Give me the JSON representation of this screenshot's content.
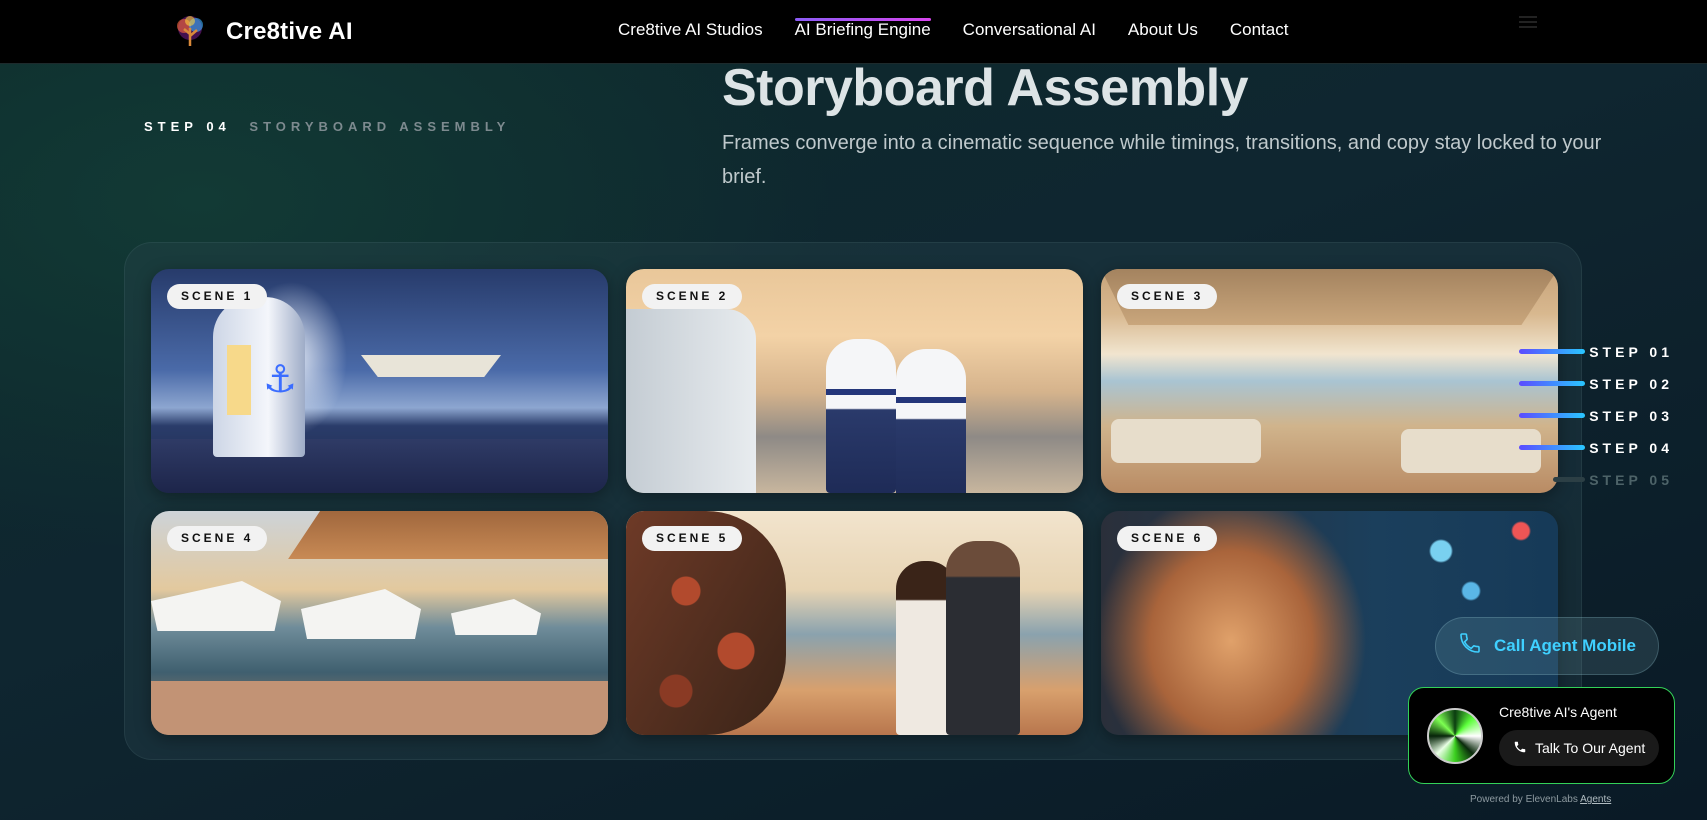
{
  "nav": {
    "brand": "Cre8tive AI",
    "items": [
      {
        "label": "Cre8tive AI Studios",
        "active": false
      },
      {
        "label": "AI Briefing Engine",
        "active": true
      },
      {
        "label": "Conversational AI",
        "active": false
      },
      {
        "label": "About Us",
        "active": false
      },
      {
        "label": "Contact",
        "active": false
      }
    ]
  },
  "section": {
    "step_num": "STEP 04",
    "step_text": "STORYBOARD ASSEMBLY",
    "title": "Storyboard Assembly",
    "description": "Frames converge into a cinematic sequence while timings, transitions, and copy stay locked to your brief."
  },
  "scenes": [
    {
      "label": "SCENE 1"
    },
    {
      "label": "SCENE 2"
    },
    {
      "label": "SCENE 3"
    },
    {
      "label": "SCENE 4"
    },
    {
      "label": "SCENE 5"
    },
    {
      "label": "SCENE 6"
    }
  ],
  "steps": [
    {
      "label": "STEP 01",
      "done": true
    },
    {
      "label": "STEP 02",
      "done": true
    },
    {
      "label": "STEP 03",
      "done": true
    },
    {
      "label": "STEP 04",
      "done": true
    },
    {
      "label": "STEP 05",
      "done": false
    }
  ],
  "call_button": {
    "label": "Call Agent Mobile"
  },
  "agent": {
    "title": "Cre8tive AI's Agent",
    "button": "Talk To Our Agent",
    "powered_prefix": "Powered by ElevenLabs",
    "powered_link": "Agents"
  },
  "colors": {
    "accent": "#3fd0ff",
    "agent_border": "#33d158",
    "active_underline": "#d946ef"
  }
}
